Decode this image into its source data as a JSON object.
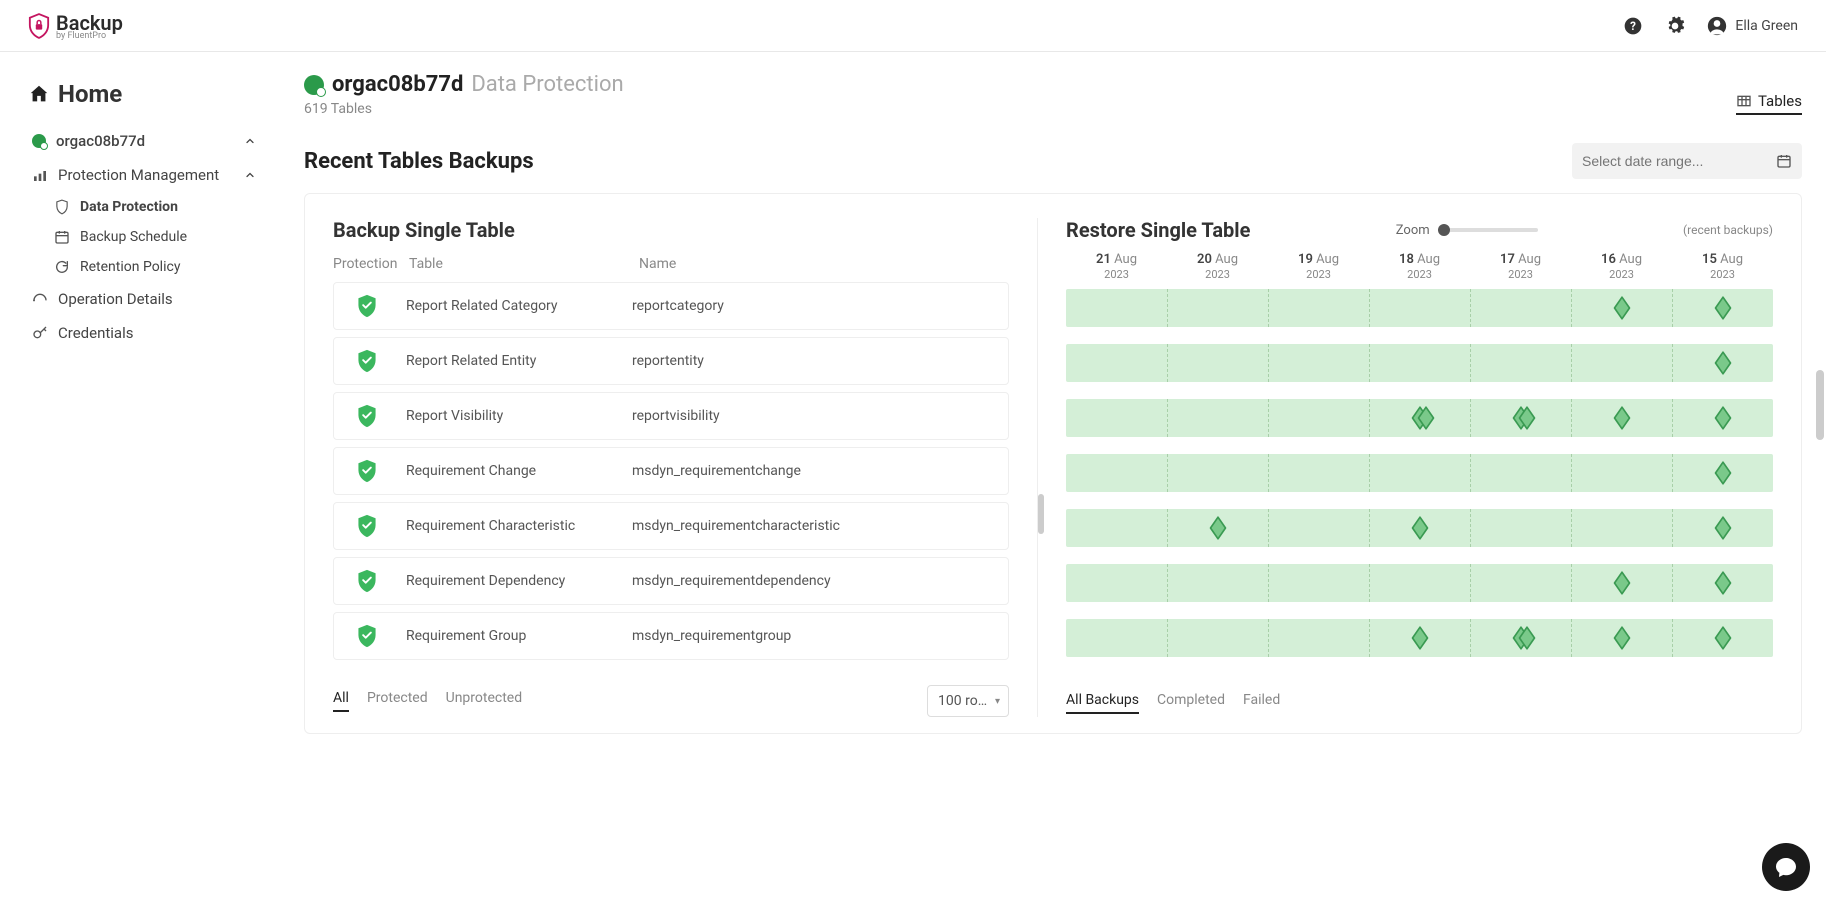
{
  "header": {
    "logo_text": "Backup",
    "logo_sub": "by FluentPro",
    "user_name": "Ella Green"
  },
  "sidebar": {
    "home": "Home",
    "org": "orgac08b77d",
    "protection_mgmt": "Protection Management",
    "items": {
      "data_protection": "Data Protection",
      "backup_schedule": "Backup Schedule",
      "retention_policy": "Retention Policy"
    },
    "operation_details": "Operation Details",
    "credentials": "Credentials"
  },
  "page": {
    "org": "orgac08b77d",
    "title": "Data Protection",
    "subtitle": "619 Tables",
    "tab_tables": "Tables",
    "section_title": "Recent Tables Backups",
    "date_placeholder": "Select date range..."
  },
  "left": {
    "title": "Backup Single Table",
    "cols": {
      "protection": "Protection",
      "table": "Table",
      "name": "Name"
    },
    "filters": {
      "all": "All",
      "protected": "Protected",
      "unprotected": "Unprotected"
    },
    "rows_per_page": "100 ro…",
    "rows": [
      {
        "table": "Report Related Category",
        "name": "reportcategory"
      },
      {
        "table": "Report Related Entity",
        "name": "reportentity"
      },
      {
        "table": "Report Visibility",
        "name": "reportvisibility"
      },
      {
        "table": "Requirement Change",
        "name": "msdyn_requirementchange"
      },
      {
        "table": "Requirement Characteristic",
        "name": "msdyn_requirementcharacteristic"
      },
      {
        "table": "Requirement Dependency",
        "name": "msdyn_requirementdependency"
      },
      {
        "table": "Requirement Group",
        "name": "msdyn_requirementgroup"
      }
    ]
  },
  "right": {
    "title": "Restore Single Table",
    "zoom": "Zoom",
    "recent": "(recent backups)",
    "filters": {
      "all": "All Backups",
      "completed": "Completed",
      "failed": "Failed"
    },
    "days": [
      {
        "d": "21",
        "m": "Aug",
        "y": "2023"
      },
      {
        "d": "20",
        "m": "Aug",
        "y": "2023"
      },
      {
        "d": "19",
        "m": "Aug",
        "y": "2023"
      },
      {
        "d": "18",
        "m": "Aug",
        "y": "2023"
      },
      {
        "d": "17",
        "m": "Aug",
        "y": "2023"
      },
      {
        "d": "16",
        "m": "Aug",
        "y": "2023"
      },
      {
        "d": "15",
        "m": "Aug",
        "y": "2023"
      }
    ],
    "markers": [
      [
        {
          "day": 5
        },
        {
          "day": 6
        }
      ],
      [
        {
          "day": 6
        }
      ],
      [
        {
          "day": 3
        },
        {
          "day": 3,
          "off": 6
        },
        {
          "day": 4
        },
        {
          "day": 4,
          "off": 6
        },
        {
          "day": 5
        },
        {
          "day": 6
        }
      ],
      [
        {
          "day": 6
        }
      ],
      [
        {
          "day": 1
        },
        {
          "day": 3
        },
        {
          "day": 6
        }
      ],
      [
        {
          "day": 5
        },
        {
          "day": 6
        }
      ],
      [
        {
          "day": 3
        },
        {
          "day": 4
        },
        {
          "day": 4,
          "off": 6
        },
        {
          "day": 5
        },
        {
          "day": 6
        }
      ]
    ]
  }
}
